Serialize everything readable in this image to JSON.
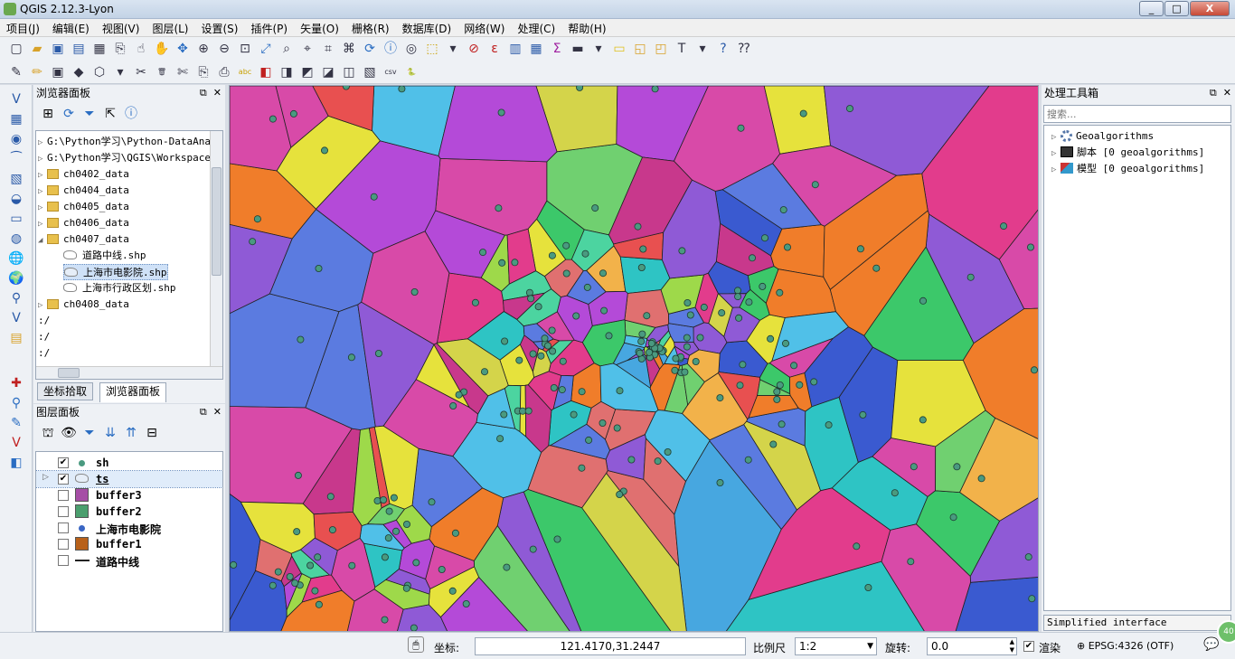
{
  "window": {
    "title": "QGIS 2.12.3-Lyon",
    "min": "_",
    "max": "□",
    "close": "X"
  },
  "menu": [
    "项目(J)",
    "编辑(E)",
    "视图(V)",
    "图层(L)",
    "设置(S)",
    "插件(P)",
    "矢量(O)",
    "栅格(R)",
    "数据库(D)",
    "网络(W)",
    "处理(C)",
    "帮助(H)"
  ],
  "browser": {
    "title": "浏览器面板",
    "items": [
      "G:\\Python学习\\Python-DataAnal:",
      "G:\\Python学习\\QGIS\\Workspace\\(",
      "ch0402_data",
      "ch0404_data",
      "ch0405_data",
      "ch0406_data",
      "ch0407_data",
      "道路中线.shp",
      "上海市电影院.shp",
      "上海市行政区划.shp",
      "ch0408_data",
      ":/",
      ":/",
      ":/"
    ]
  },
  "tabs": {
    "coord": "坐标拾取",
    "browser": "浏览器面板"
  },
  "layers": {
    "title": "图层面板",
    "items": [
      {
        "name": "sh",
        "checked": true,
        "color": "#4a9a80",
        "kind": "point"
      },
      {
        "name": "ts",
        "checked": true,
        "color": "#a9c4e6",
        "kind": "polygon-group"
      },
      {
        "name": "buffer3",
        "checked": false,
        "color": "#a64ea6",
        "kind": "fill"
      },
      {
        "name": "buffer2",
        "checked": false,
        "color": "#4b9f6e",
        "kind": "fill"
      },
      {
        "name": "上海市电影院",
        "checked": false,
        "color": "#3a66c4",
        "kind": "point"
      },
      {
        "name": "buffer1",
        "checked": false,
        "color": "#b8611a",
        "kind": "fill"
      },
      {
        "name": "道路中线",
        "checked": false,
        "color": "#222222",
        "kind": "line"
      }
    ]
  },
  "processing": {
    "title": "处理工具箱",
    "search_placeholder": "搜索...",
    "items": [
      "Geoalgorithms",
      "脚本 [0 geoalgorithms]",
      "模型 [0 geoalgorithms]"
    ],
    "interface_toggle": "Simplified interface"
  },
  "status": {
    "coord_label": "坐标:",
    "coord_value": "121.4170,31.2447",
    "scale_label": "比例尺",
    "scale_value": "1:2",
    "rotation_label": "旋转:",
    "rotation_value": "0.0",
    "render_label": "渲染",
    "crs": "EPSG:4326 (OTF)"
  },
  "map_colors": [
    "#e23c8c",
    "#3cc86a",
    "#8f5ad6",
    "#f07d2a",
    "#2ec4c4",
    "#d4d44a",
    "#5b7be0",
    "#e85050",
    "#9ed94a",
    "#d84aa8",
    "#47a7e0",
    "#f2b24a",
    "#4cd4a0",
    "#b44ad8",
    "#e6e23c",
    "#3a5ad0",
    "#70d070",
    "#e07070",
    "#50c0e8",
    "#c8388c"
  ]
}
